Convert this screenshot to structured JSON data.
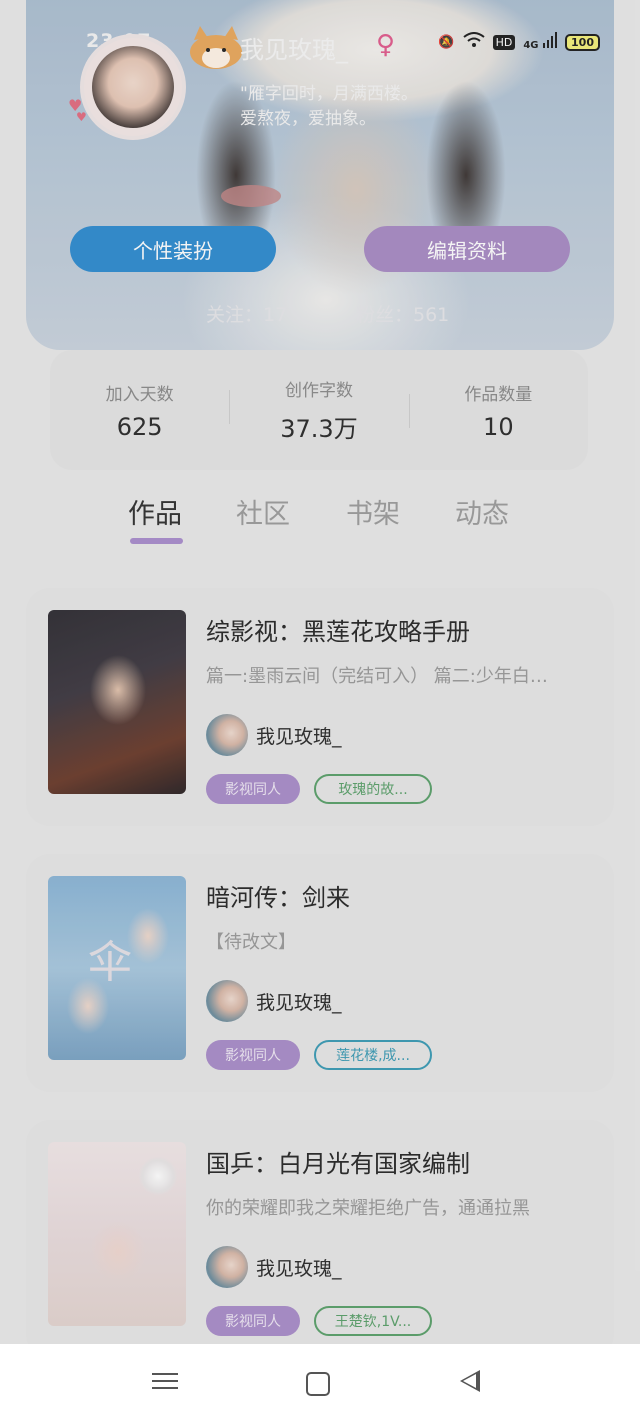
{
  "status_bar": {
    "time": "23:07",
    "battery": "100",
    "network": "4G",
    "hd": "HD"
  },
  "profile": {
    "username": "我见玫瑰_",
    "gender_symbol": "♀",
    "bio_line1": "\"雁字回时，月满西楼。",
    "bio_line2": "爱熬夜，爱抽象。",
    "dress_button": "个性装扮",
    "edit_button": "编辑资料",
    "following": "关注：17",
    "followers": "粉丝：561"
  },
  "stats": [
    {
      "label": "加入天数",
      "value": "625"
    },
    {
      "label": "创作字数",
      "value": "37.3万"
    },
    {
      "label": "作品数量",
      "value": "10"
    }
  ],
  "tabs": [
    {
      "label": "作品",
      "active": true
    },
    {
      "label": "社区",
      "active": false
    },
    {
      "label": "书架",
      "active": false
    },
    {
      "label": "动态",
      "active": false
    }
  ],
  "works": [
    {
      "title": "综影视：黑莲花攻略手册",
      "description": "篇一:墨雨云间（完结可入） 篇二:少年白…",
      "author": "我见玫瑰_",
      "category_tag": "影视同人",
      "sub_tag": "玫瑰的故...",
      "sub_tag_color": "#5aa06a"
    },
    {
      "title": "暗河传：剑来",
      "description": "【待改文】",
      "author": "我见玫瑰_",
      "category_tag": "影视同人",
      "sub_tag": "莲花楼,成...",
      "sub_tag_color": "#3a9bb5"
    },
    {
      "title": "国乒：白月光有国家编制",
      "description": "你的荣耀即我之荣耀拒绝广告，通通拉黑",
      "author": "我见玫瑰_",
      "category_tag": "影视同人",
      "sub_tag": "王楚钦,1V...",
      "sub_tag_color": "#5aa06a"
    }
  ],
  "colors": {
    "accent_purple": "#a98cc9",
    "dress_button_blue": "#2e8bd0",
    "edit_button_purple": "#a88ac4"
  }
}
